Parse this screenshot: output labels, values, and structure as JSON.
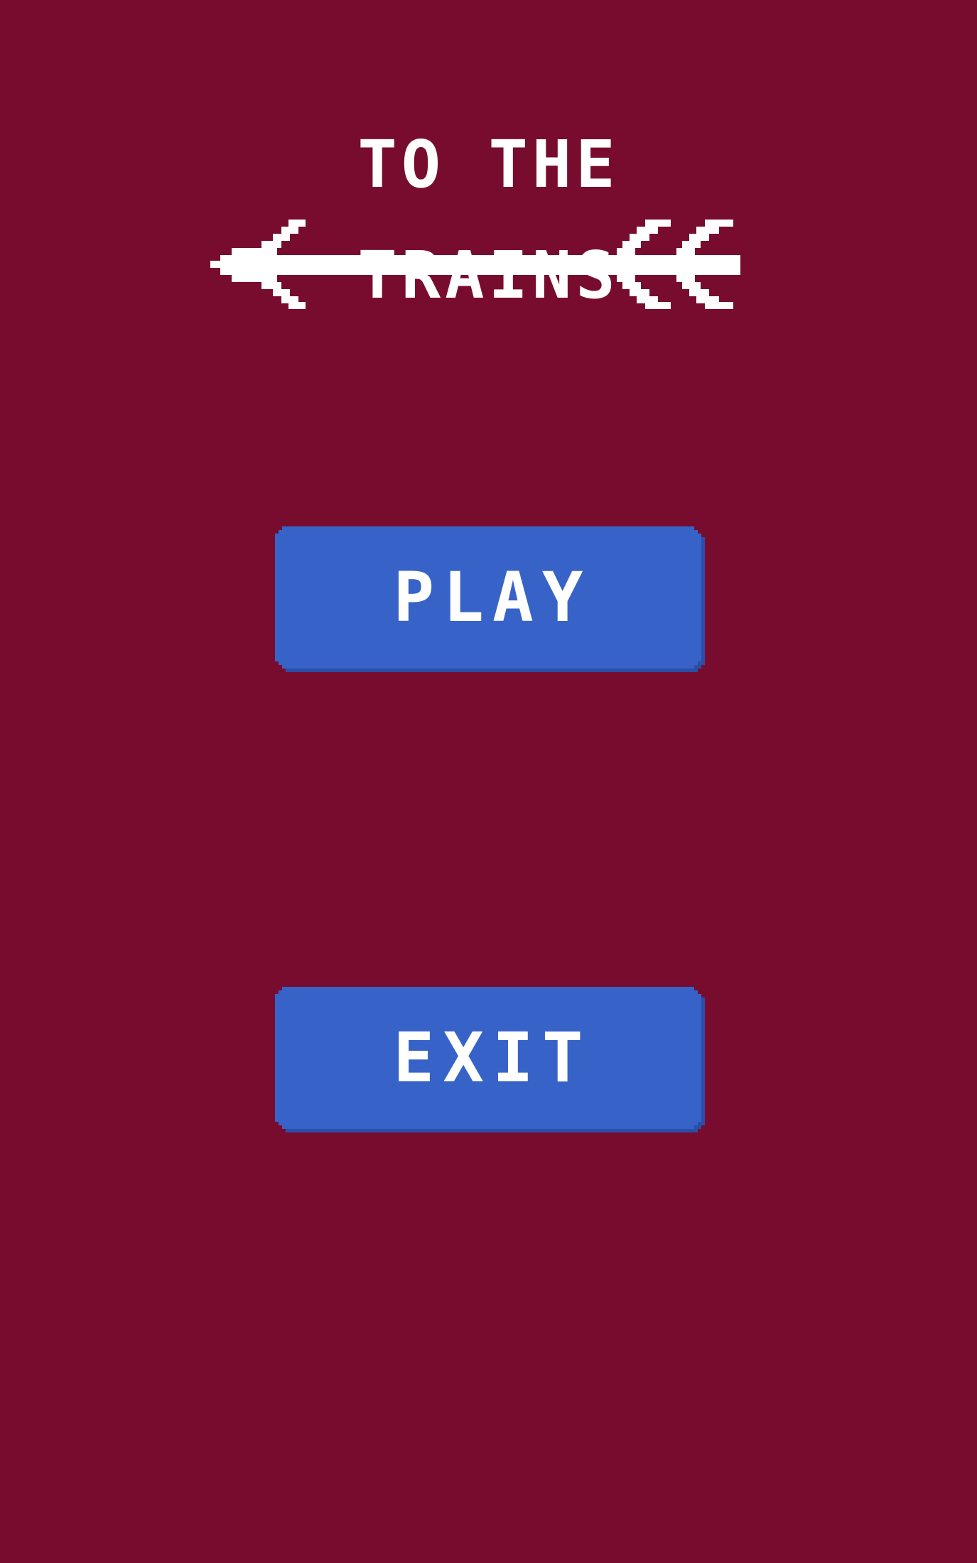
{
  "game": {
    "title_line1": "TO THE",
    "title_line2": "TRAINS"
  },
  "menu": {
    "play_label": "PLAY",
    "exit_label": "EXIT"
  },
  "colors": {
    "background": "#780C2F",
    "button": "#3763C8",
    "button_shadow": "#2A4FA8",
    "text": "#FFFFFF"
  },
  "icons": {
    "logo_graphic": "arrow-icon"
  }
}
